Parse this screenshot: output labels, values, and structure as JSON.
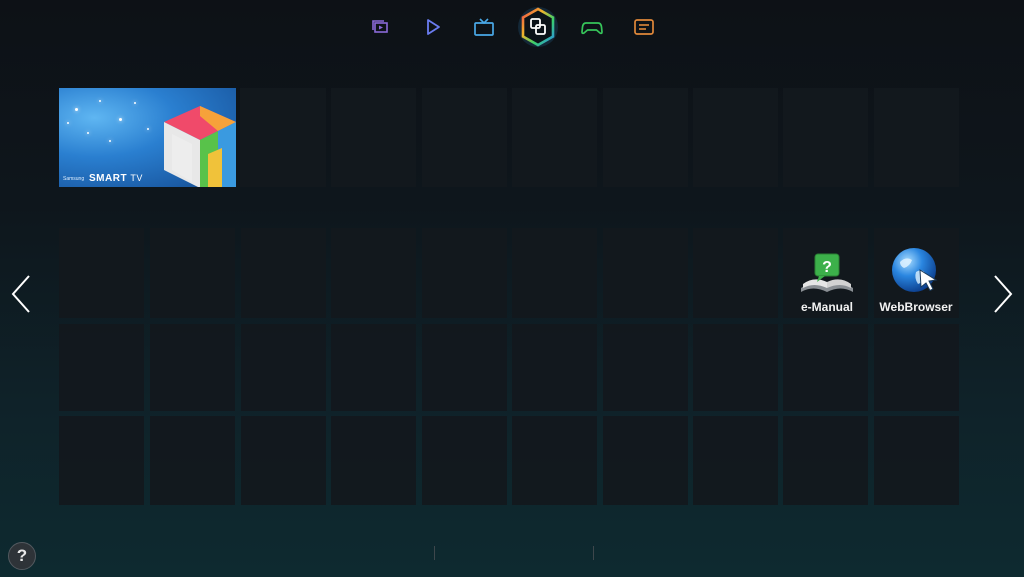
{
  "top_nav": {
    "items": [
      {
        "name": "Social",
        "icon": "photo-stack-icon",
        "color": "#8a6ad8"
      },
      {
        "name": "Movies & TV Shows",
        "icon": "play-icon",
        "color": "#6a7cf0"
      },
      {
        "name": "On TV",
        "icon": "tv-icon",
        "color": "#49a9e8"
      },
      {
        "name": "Apps",
        "icon": "apps-icon",
        "color": "#ffffff",
        "active": true
      },
      {
        "name": "Games",
        "icon": "gamepad-icon",
        "color": "#36c45a"
      },
      {
        "name": "Notes",
        "icon": "note-icon",
        "color": "#e0883a"
      }
    ]
  },
  "banner": {
    "brand": "Samsung",
    "logo_main": "SMART",
    "logo_suffix": "TV"
  },
  "apps": [
    {
      "label": "e-Manual",
      "icon": "book-help-icon"
    },
    {
      "label": "WebBrowser",
      "icon": "globe-cursor-icon"
    }
  ],
  "help": {
    "label": "?"
  }
}
